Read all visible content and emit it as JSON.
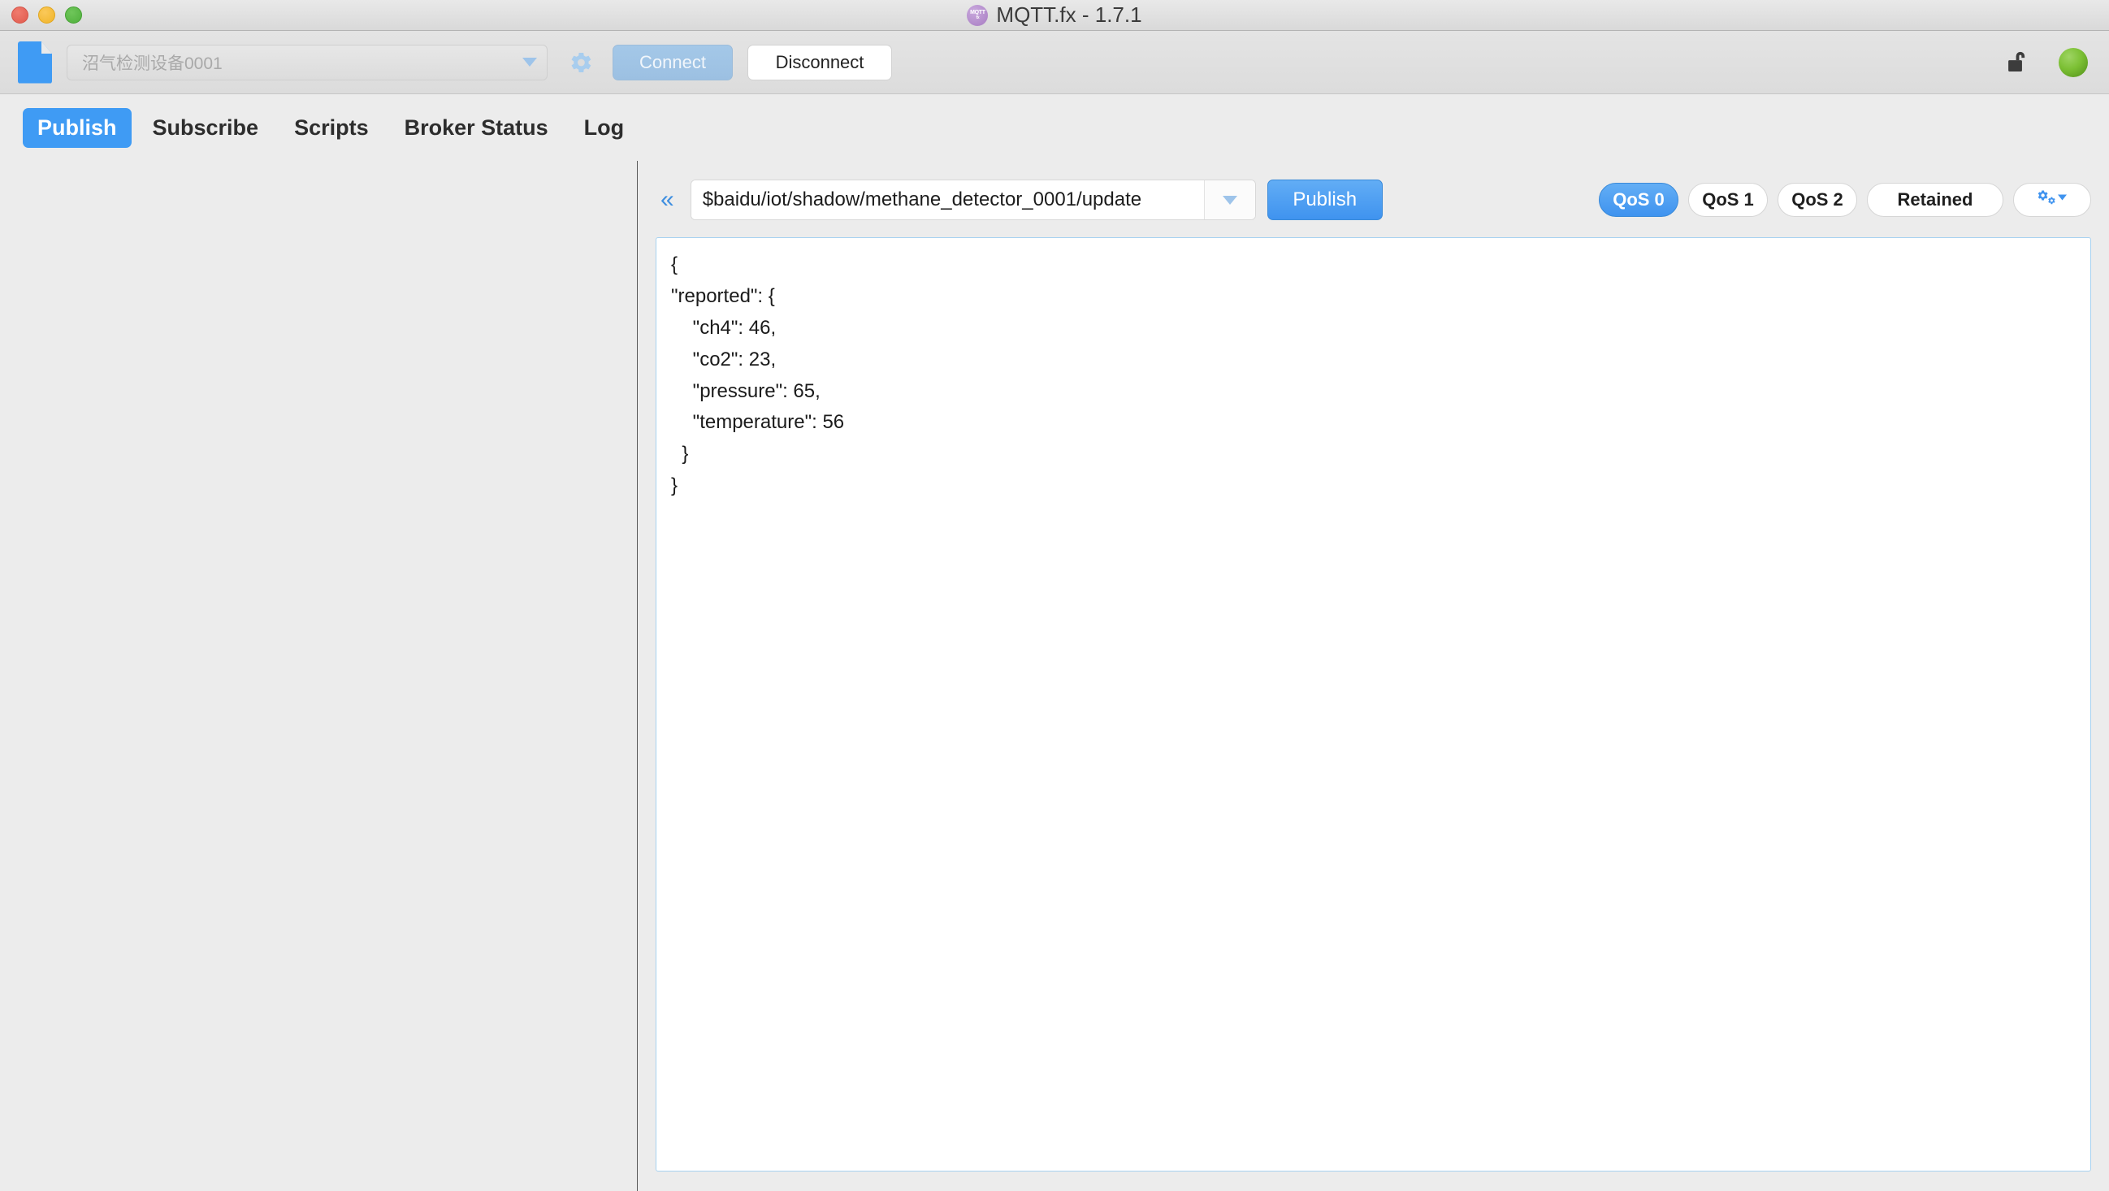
{
  "window": {
    "title": "MQTT.fx - 1.7.1",
    "badge_line1": "MQTT",
    "badge_line2": "fx",
    "controls": {
      "close": "close-button",
      "minimize": "minimize-button",
      "maximize": "maximize-button"
    }
  },
  "toolbar": {
    "file_icon": "file-icon",
    "profile_value": "沼气检测设备0001",
    "profile_placeholder": "沼气检测设备0001",
    "settings_icon": "gear-icon",
    "connect_label": "Connect",
    "disconnect_label": "Disconnect",
    "lock_icon": "unlocked-padlock-icon",
    "status_icon": "connection-status-indicator",
    "status_color": "#7cc034",
    "accent_color": "#3f9bf4"
  },
  "tabs": [
    {
      "label": "Publish",
      "active": true
    },
    {
      "label": "Subscribe",
      "active": false
    },
    {
      "label": "Scripts",
      "active": false
    },
    {
      "label": "Broker Status",
      "active": false
    },
    {
      "label": "Log",
      "active": false
    }
  ],
  "publish": {
    "collapse_icon": "«",
    "topic": "$baidu/iot/shadow/methane_detector_0001/update",
    "topic_placeholder": "Topic",
    "topic_dropdown_icon": "chevron-down-icon",
    "publish_label": "Publish",
    "qos": [
      {
        "label": "QoS 0",
        "active": true
      },
      {
        "label": "QoS 1",
        "active": false
      },
      {
        "label": "QoS 2",
        "active": false
      }
    ],
    "retained_label": "Retained",
    "options_icon": "gears-dropdown-icon",
    "payload": "{\n\"reported\": {\n    \"ch4\": 46,\n    \"co2\": 23,\n    \"pressure\": 65,\n    \"temperature\": 56\n  }\n}"
  }
}
